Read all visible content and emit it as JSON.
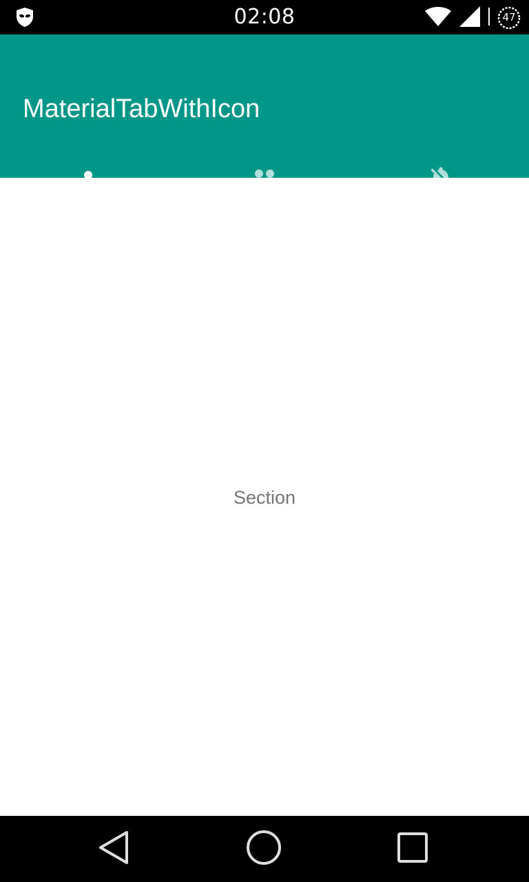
{
  "status_bar": {
    "time": "02:08",
    "battery_level": "47",
    "icons": [
      "mask-icon",
      "wifi-icon",
      "signal-icon",
      "battery-icon"
    ]
  },
  "app_bar": {
    "title": "MaterialTabWithIcon",
    "background_color": "#009688"
  },
  "tabs": [
    {
      "icon": "person-icon",
      "selected": true
    },
    {
      "icon": "group-icon",
      "selected": false
    },
    {
      "icon": "notifications-off-icon",
      "selected": false
    }
  ],
  "tab_indicator_color": "#FDD835",
  "content": {
    "section_label": "Section"
  },
  "nav_bar": {
    "buttons": [
      "back-icon",
      "home-icon",
      "recents-icon"
    ]
  }
}
